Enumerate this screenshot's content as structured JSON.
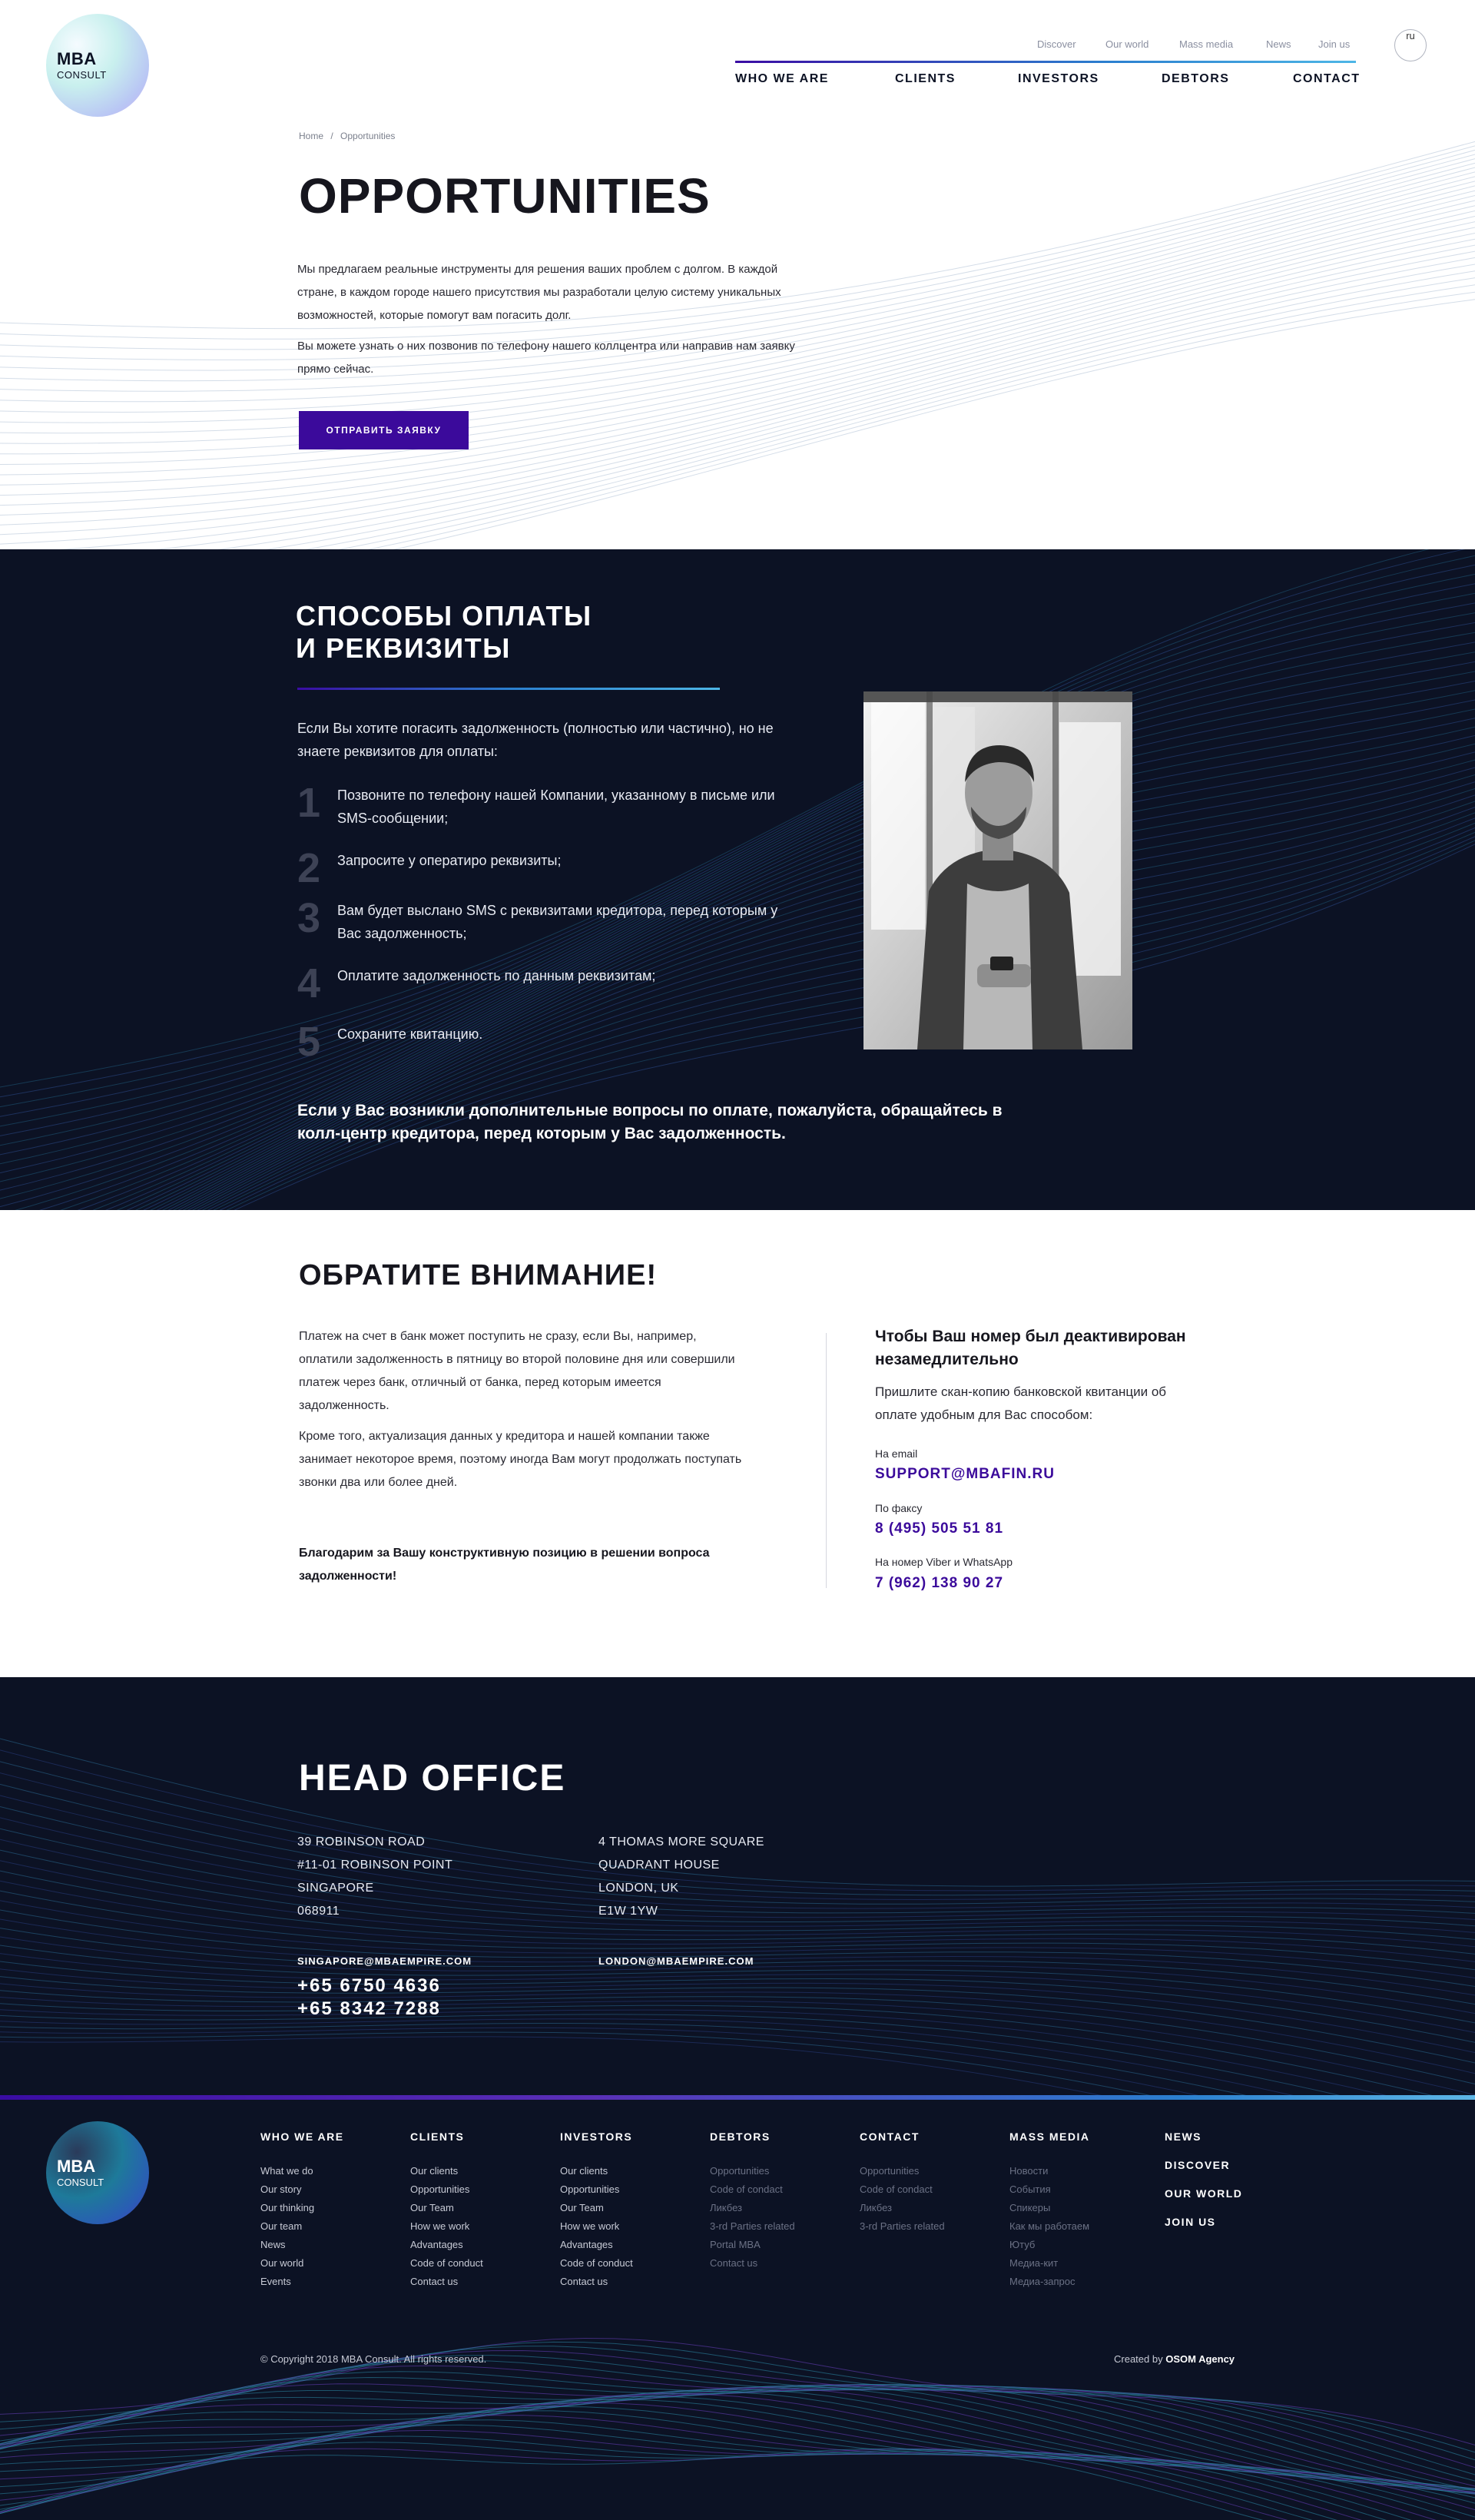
{
  "header": {
    "logo": {
      "line1": "MBA",
      "line2": "CONSULT"
    },
    "top_links": [
      "Discover",
      "Our world",
      "Mass media",
      "News",
      "Join us"
    ],
    "main_nav": [
      "WHO WE ARE",
      "CLIENTS",
      "INVESTORS",
      "DEBTORS",
      "CONTACT"
    ],
    "lang": "ru"
  },
  "breadcrumb": {
    "home": "Home",
    "separator": "/",
    "current": "Opportunities"
  },
  "hero": {
    "title": "OPPORTUNITIES",
    "paragraph1": "Мы предлагаем реальные инструменты для решения ваших проблем с долгом. В каждой стране, в каждом городе нашего присутствия мы разработали целую систему уникальных возможностей, которые помогут вам погасить долг.",
    "paragraph2": "Вы можете узнать о них позвонив по телефону нашего коллцентра или направив нам заявку прямо сейчас.",
    "button": "ОТПРАВИТЬ ЗАЯВКУ"
  },
  "payment": {
    "title_line1": "СПОСОБЫ ОПЛАТЫ",
    "title_line2": "И РЕКВИЗИТЫ",
    "intro": "Если Вы хотите погасить задолженность (полностью или частично), но не знаете реквизитов для оплаты:",
    "steps": [
      {
        "num": "1",
        "text": "Позвоните по телефону нашей Компании, указанному в письме или SMS-сообщении;"
      },
      {
        "num": "2",
        "text": "Запросите у оператиро реквизиты;"
      },
      {
        "num": "3",
        "text": "Вам будет выслано SMS с реквизитами кредитора, перед которым у Вас задолженность;"
      },
      {
        "num": "4",
        "text": "Оплатите задолженность по данным реквизитам;"
      },
      {
        "num": "5",
        "text": "Сохраните квитанцию."
      }
    ],
    "note": "Если у Вас возникли дополнительные вопросы по оплате, пожалуйста, обращайтесь в колл-центр кредитора, перед которым у Вас задолженность."
  },
  "attention": {
    "title": "ОБРАТИТЕ ВНИМАНИЕ!",
    "paragraph1": "Платеж на счет в банк может поступить не сразу, если Вы, например, оплатили задолженность в пятницу во второй половине дня или совершили платеж через банк, отличный от банка, перед которым имеется задолженность.",
    "paragraph2": "Кроме того, актуализация данных у кредитора и нашей компании также занимает некоторое время, поэтому иногда Вам могут продолжать поступать звонки два или более дней.",
    "thanks": "Благодарим за Вашу конструктивную позицию в решении вопроса задолженности!",
    "right_title": "Чтобы Ваш номер был деактивирован незамедлительно",
    "right_sub": "Пришлите скан-копию банковской квитанции об оплате удобным для Вас способом:",
    "email_label": "На email",
    "email": "SUPPORT@MBAFIN.RU",
    "fax_label": "По факсу",
    "fax": "8 (495) 505 51 81",
    "viber_label": "На номер Viber и WhatsApp",
    "viber": "7 (962) 138 90 27"
  },
  "office": {
    "title": "HEAD OFFICE",
    "singapore": {
      "line1": "39 ROBINSON ROAD",
      "line2": "#11-01 ROBINSON POINT",
      "line3": "SINGAPORE",
      "line4": "068911",
      "email": "SINGAPORE@MBAEMPIRE.COM",
      "phone1": "+65 6750 4636",
      "phone2": "+65 8342 7288"
    },
    "london": {
      "line1": "4 THOMAS MORE SQUARE",
      "line2": "QUADRANT HOUSE",
      "line3": "LONDON, UK",
      "line4": "E1W 1YW",
      "email": "LONDON@MBAEMPIRE.COM"
    }
  },
  "footer": {
    "logo": {
      "line1": "MBA",
      "line2": "CONSULT"
    },
    "columns": [
      {
        "title": "WHO WE ARE",
        "items": [
          "What we do",
          "Our story",
          "Our thinking",
          "Our team",
          "News",
          "Our world",
          "Events"
        ]
      },
      {
        "title": "CLIENTS",
        "items": [
          "Our clients",
          "Opportunities",
          "Our Team",
          "How we work",
          "Advantages",
          "Code of conduct",
          "Contact us"
        ]
      },
      {
        "title": "INVESTORS",
        "items": [
          "Our clients",
          "Opportunities",
          "Our Team",
          "How we work",
          "Advantages",
          "Code of conduct",
          "Contact us"
        ]
      },
      {
        "title": "DEBTORS",
        "items": [
          "Opportunities",
          "Code of condact",
          "Ликбез",
          "3-rd Parties related",
          "Portal MBA",
          "Contact us"
        ]
      },
      {
        "title": "CONTACT",
        "items": [
          "Opportunities",
          "Code of condact",
          "Ликбез",
          "3-rd Parties related"
        ]
      },
      {
        "title": "MASS MEDIA",
        "items": [
          "Новости",
          "События",
          "Спикеры",
          "Как мы работаем",
          "Ютуб",
          "Медиа-кит",
          "Медиа-запрос"
        ]
      }
    ],
    "side_links": [
      "NEWS",
      "DISCOVER",
      "OUR WORLD",
      "JOIN US"
    ],
    "copyright": "© Copyright 2018 MBA Consult. All rights reserved.",
    "created_prefix": "Created by",
    "created_by": "OSOM Agency"
  }
}
